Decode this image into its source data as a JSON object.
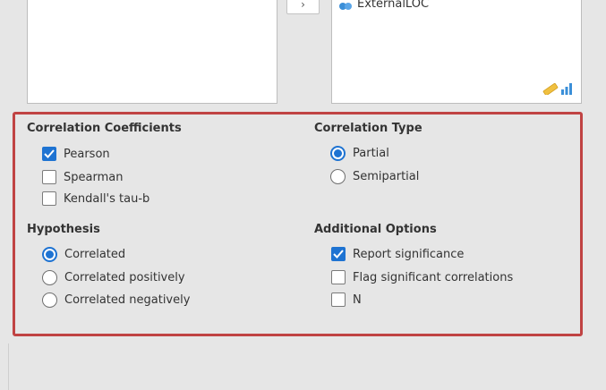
{
  "move_button": {
    "label": "›"
  },
  "right_list": {
    "items": [
      {
        "label": "ExternalLOC",
        "icon": "continuous-variable-icon"
      }
    ]
  },
  "measure_badge": {
    "icons": [
      "ruler-icon",
      "bar-chart-icon"
    ],
    "colors": {
      "ruler": "#f0c040",
      "bars": "#3b8fd8"
    }
  },
  "panel": {
    "highlight_color": "#c04343",
    "correlation_coefficients": {
      "heading": "Correlation Coefficients",
      "options": [
        {
          "label": "Pearson",
          "checked": true
        },
        {
          "label": "Spearman",
          "checked": false
        },
        {
          "label": "Kendall's tau-b",
          "checked": false
        }
      ]
    },
    "correlation_type": {
      "heading": "Correlation Type",
      "options": [
        {
          "label": "Partial",
          "selected": true
        },
        {
          "label": "Semipartial",
          "selected": false
        }
      ]
    },
    "hypothesis": {
      "heading": "Hypothesis",
      "options": [
        {
          "label": "Correlated",
          "selected": true
        },
        {
          "label": "Correlated positively",
          "selected": false
        },
        {
          "label": "Correlated negatively",
          "selected": false
        }
      ]
    },
    "additional_options": {
      "heading": "Additional Options",
      "options": [
        {
          "label": "Report significance",
          "checked": true
        },
        {
          "label": "Flag significant correlations",
          "checked": false
        },
        {
          "label": "N",
          "checked": false
        }
      ]
    }
  },
  "accent_color": "#1e73d2"
}
